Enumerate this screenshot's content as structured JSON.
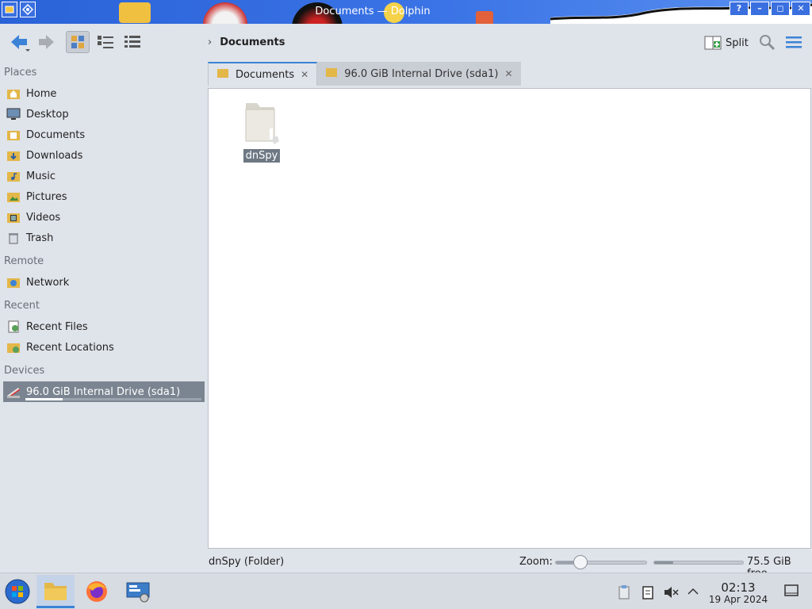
{
  "window": {
    "title": "Documents — Dolphin"
  },
  "toolbar": {
    "breadcrumb": "Documents",
    "split_label": "Split"
  },
  "sidebar": {
    "sections": {
      "places": "Places",
      "remote": "Remote",
      "recent": "Recent",
      "devices": "Devices"
    },
    "places": [
      {
        "label": "Home",
        "icon": "home-folder-icon"
      },
      {
        "label": "Desktop",
        "icon": "desktop-icon"
      },
      {
        "label": "Documents",
        "icon": "documents-folder-icon"
      },
      {
        "label": "Downloads",
        "icon": "downloads-folder-icon"
      },
      {
        "label": "Music",
        "icon": "music-folder-icon"
      },
      {
        "label": "Pictures",
        "icon": "pictures-folder-icon"
      },
      {
        "label": "Videos",
        "icon": "videos-folder-icon"
      },
      {
        "label": "Trash",
        "icon": "trash-icon"
      }
    ],
    "remote": [
      {
        "label": "Network",
        "icon": "network-folder-icon"
      }
    ],
    "recent": [
      {
        "label": "Recent Files",
        "icon": "recent-files-icon"
      },
      {
        "label": "Recent Locations",
        "icon": "recent-locations-icon"
      }
    ],
    "devices": [
      {
        "label": "96.0 GiB Internal Drive (sda1)",
        "icon": "drive-icon",
        "used_fraction": 0.21
      }
    ]
  },
  "tabs": [
    {
      "label": "Documents",
      "active": true
    },
    {
      "label": "96.0 GiB Internal Drive (sda1)",
      "active": false
    }
  ],
  "files": [
    {
      "name": "dnSpy",
      "type": "folder",
      "selected": true
    }
  ],
  "statusbar": {
    "selection_text": "dnSpy (Folder)",
    "zoom_label": "Zoom:",
    "zoom_fraction": 0.28,
    "free_space": "75.5 GiB free",
    "used_fraction": 0.21
  },
  "taskbar": {
    "time": "02:13",
    "date": "19 Apr 2024"
  },
  "colors": {
    "accent": "#3b83d6",
    "selection": "#7b8591",
    "titlebar": "#2a62d8"
  }
}
